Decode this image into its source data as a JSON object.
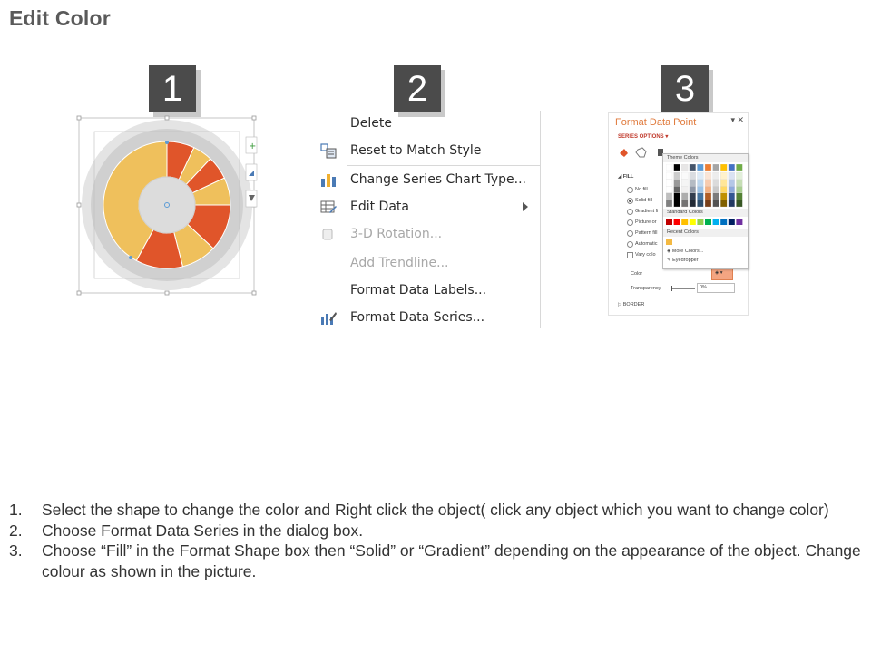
{
  "page": {
    "title": "Edit Color"
  },
  "steps": [
    {
      "number": "1"
    },
    {
      "number": "2"
    },
    {
      "number": "3"
    }
  ],
  "donut": {
    "segments": [
      {
        "fraction": 0.07,
        "color": "#e0552a"
      },
      {
        "fraction": 0.05,
        "color": "#efc05c"
      },
      {
        "fraction": 0.06,
        "color": "#e0552a"
      },
      {
        "fraction": 0.07,
        "color": "#efc05c"
      },
      {
        "fraction": 0.12,
        "color": "#e0552a"
      },
      {
        "fraction": 0.09,
        "color": "#efc05c"
      },
      {
        "fraction": 0.12,
        "color": "#e0552a"
      },
      {
        "fraction": 0.42,
        "color": "#efc05c"
      }
    ]
  },
  "context_menu": {
    "items": [
      {
        "label": "Delete",
        "icon": "none",
        "disabled": false
      },
      {
        "label": "Reset to Match Style",
        "icon": "reset-style-icon",
        "disabled": false
      },
      {
        "label": "Change Series Chart Type...",
        "icon": "bar-chart-icon",
        "disabled": false
      },
      {
        "label": "Edit Data",
        "icon": "edit-data-icon",
        "disabled": false,
        "submenu": true
      },
      {
        "label": "3-D Rotation...",
        "icon": "cube-icon",
        "disabled": true
      },
      {
        "label": "Add Trendline...",
        "icon": "none",
        "disabled": true
      },
      {
        "label": "Format Data Labels...",
        "icon": "none",
        "disabled": false
      },
      {
        "label": "Format Data Series...",
        "icon": "format-series-icon",
        "disabled": false
      }
    ]
  },
  "format_pane": {
    "title": "Format Data Point",
    "tab": "SERIES OPTIONS",
    "section_fill": "FILL",
    "options": [
      "No fill",
      "Solid fill",
      "Gradient fi",
      "Picture or",
      "Pattern fill",
      "Automatic",
      "Vary colo"
    ],
    "color_label": "Color",
    "transparency_label": "Transparency",
    "transparency_value": "0%",
    "section_border": "BORDER",
    "popup": {
      "theme_label": "Theme Colors",
      "standard_label": "Standard Colors",
      "recent_label": "Recent Colors",
      "more_colors": "More Colors...",
      "eyedropper": "Eyedropper"
    },
    "theme_top": [
      "#ffffff",
      "#000000",
      "#e7e6e6",
      "#44546a",
      "#5b9bd5",
      "#ed7d31",
      "#a5a5a5",
      "#ffc000",
      "#4472c4",
      "#70ad47"
    ],
    "standard_colors": [
      "#c00000",
      "#ff0000",
      "#ffc000",
      "#ffff00",
      "#92d050",
      "#00b050",
      "#00b0f0",
      "#0070c0",
      "#002060",
      "#7030a0"
    ],
    "recent_color": "#f4b942"
  },
  "instructions": [
    {
      "num": "1.",
      "text": "Select the shape to change the color and Right click the object( click any object which you want to change color)"
    },
    {
      "num": "2.",
      "text": "Choose Format Data Series in the dialog box."
    },
    {
      "num": "3.",
      "text": "Choose “Fill” in the Format Shape box then “Solid” or “Gradient” depending on the appearance of the object. Change colour as shown in the picture."
    }
  ]
}
